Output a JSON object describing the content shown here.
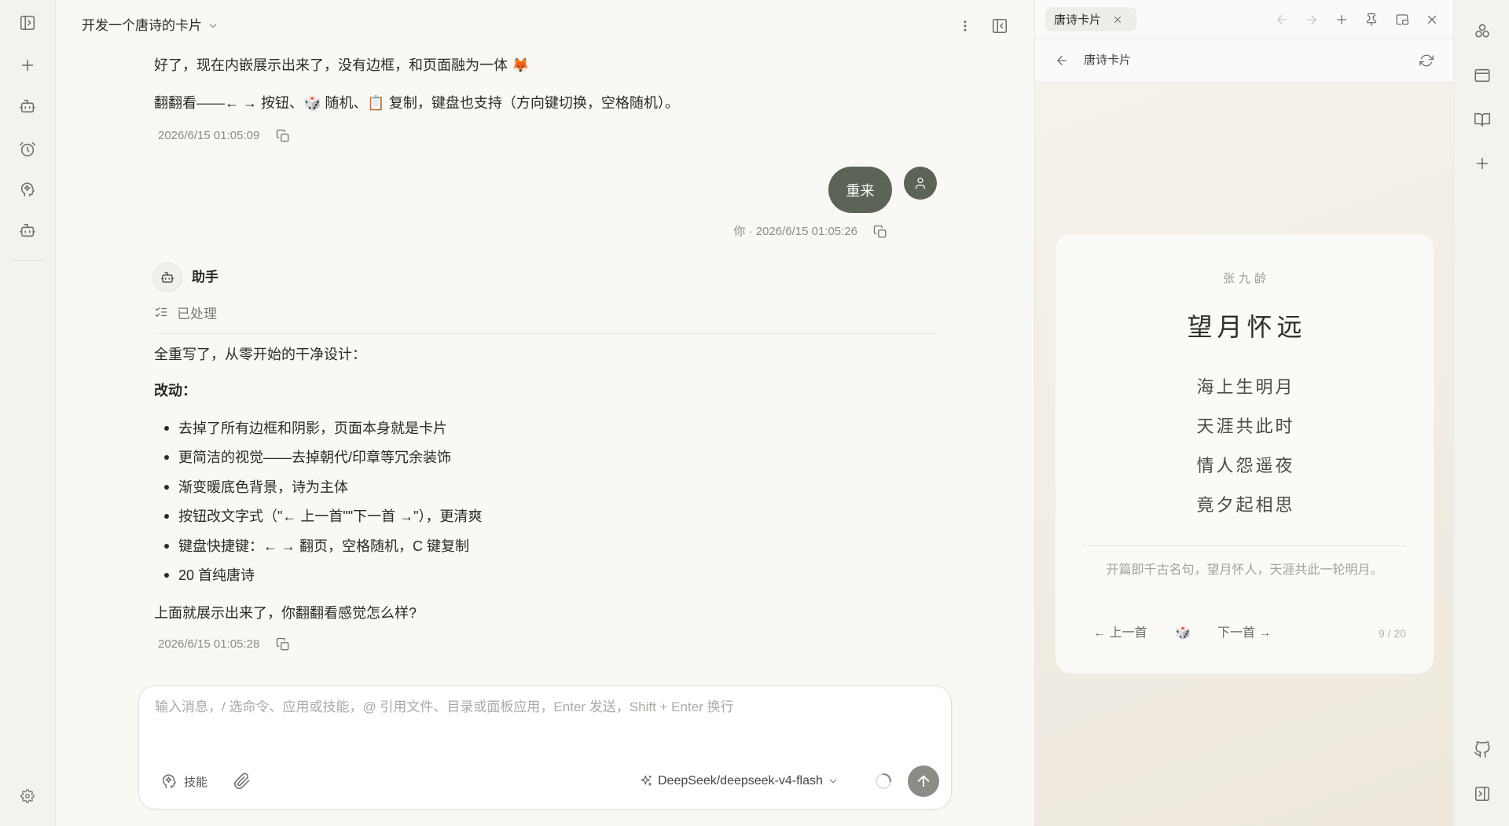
{
  "left_sidebar": {
    "icons": [
      "sidebar-toggle-icon",
      "plus-icon",
      "bot-icon",
      "alarm-clock-icon",
      "skills-icon",
      "bot-icon"
    ],
    "bottom_icon": "gear-icon"
  },
  "header": {
    "title": "开发一个唐诗的卡片",
    "right_icons": [
      "more-vertical-icon",
      "panel-toggle-icon"
    ]
  },
  "chat": {
    "msg1": {
      "lines": [
        "好了，现在内嵌展示出来了，没有边框，和页面融为一体 🦊",
        "翻翻看——← → 按钮、🎲 随机、📋 复制，键盘也支持（方向键切换，空格随机）。"
      ],
      "timestamp": "2026/6/15 01:05:09"
    },
    "user_msg": {
      "text": "重来",
      "meta": "你 · 2026/6/15 01:05:26"
    },
    "assistant": {
      "name": "助手",
      "status": "已处理",
      "intro": "全重写了，从零开始的干净设计：",
      "heading": "改动：",
      "bullets": [
        "去掉了所有边框和阴影，页面本身就是卡片",
        "更简洁的视觉——去掉朝代/印章等冗余装饰",
        "渐变暖底色背景，诗为主体",
        "按钮改文字式（\"← 上一首\"\"下一首 →\"），更清爽",
        "键盘快捷键：← → 翻页，空格随机，C 键复制",
        "20 首纯唐诗"
      ],
      "closing": "上面就展示出来了，你翻翻看感觉怎么样?",
      "timestamp": "2026/6/15 01:05:28"
    }
  },
  "composer": {
    "placeholder": "输入消息，/ 选命令、应用或技能，@ 引用文件、目录或面板应用，Enter 发送，Shift + Enter 换行",
    "skill_label": "技能",
    "model": "DeepSeek/deepseek-v4-flash"
  },
  "right_panel": {
    "tab": {
      "label": "唐诗卡片"
    },
    "toolbar_icons": [
      "arrow-left-icon",
      "arrow-right-icon",
      "plus-icon",
      "pin-icon",
      "picture-in-picture-icon",
      "close-icon"
    ],
    "address": {
      "title": "唐诗卡片"
    },
    "card": {
      "author": "张九龄",
      "title": "望月怀远",
      "lines": [
        "海上生明月",
        "天涯共此时",
        "情人怨遥夜",
        "竟夕起相思"
      ],
      "note": "开篇即千古名句，望月怀人，天涯共此一轮明月。",
      "prev_label": "← 上一首",
      "random_icon": "🎲",
      "next_label": "下一首 →",
      "counter": "9 / 20"
    }
  },
  "right_sidebar": {
    "icons": [
      "apps-icon",
      "browser-icon",
      "book-icon",
      "plus-icon"
    ],
    "bottom_icons": [
      "github-icon",
      "panel-right-icon"
    ]
  },
  "colors": {
    "user_bubble": "#5b6456",
    "send_button": "#8b8c86"
  }
}
